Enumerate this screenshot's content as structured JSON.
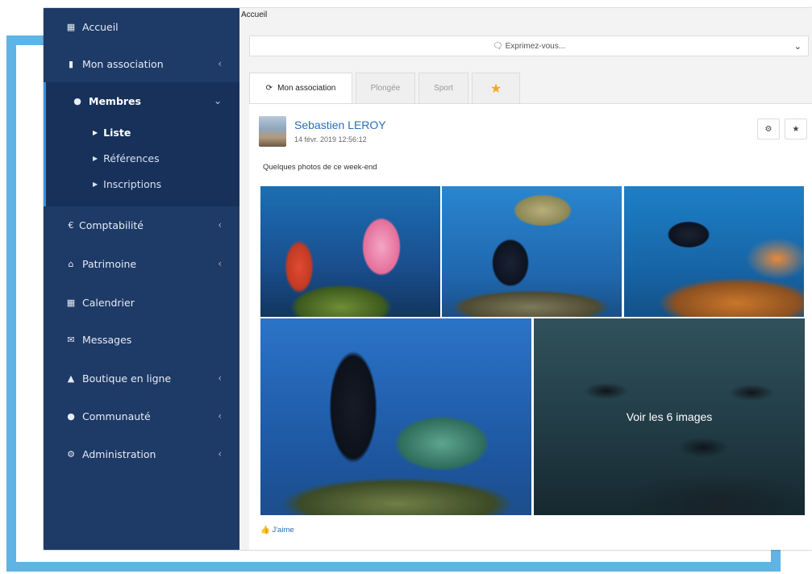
{
  "breadcrumb": "Accueil",
  "sidebar": {
    "items": [
      {
        "label": "Accueil",
        "icon": "dashboard-icon",
        "glyph": "▦",
        "chevron": ""
      },
      {
        "label": "Mon association",
        "icon": "bookmark-icon",
        "glyph": "▮",
        "chevron": "‹"
      },
      {
        "label": "Membres",
        "icon": "users-icon",
        "glyph": "👥",
        "chevron": "⌄"
      },
      {
        "label": "Comptabilité",
        "icon": "euro-icon",
        "glyph": "€",
        "chevron": "‹"
      },
      {
        "label": "Patrimoine",
        "icon": "bank-icon",
        "glyph": "🏛",
        "chevron": "‹"
      },
      {
        "label": "Calendrier",
        "icon": "calendar-icon",
        "glyph": "▦",
        "chevron": ""
      },
      {
        "label": "Messages",
        "icon": "envelope-icon",
        "glyph": "✉",
        "chevron": ""
      },
      {
        "label": "Boutique en ligne",
        "icon": "shopping-bag-icon",
        "glyph": "👜",
        "chevron": "‹"
      },
      {
        "label": "Communauté",
        "icon": "comments-icon",
        "glyph": "💬",
        "chevron": "‹"
      },
      {
        "label": "Administration",
        "icon": "cogs-icon",
        "glyph": "⚙",
        "chevron": "‹"
      }
    ],
    "submenu": [
      {
        "label": "Liste"
      },
      {
        "label": "Références"
      },
      {
        "label": "Inscriptions"
      }
    ]
  },
  "composer": {
    "placeholder": "Exprimez-vous...",
    "icon": "comment-icon"
  },
  "tabs": [
    {
      "label": "Mon association",
      "icon": "refresh-icon"
    },
    {
      "label": "Plongée"
    },
    {
      "label": "Sport"
    },
    {
      "label": "",
      "icon": "star-icon"
    }
  ],
  "post": {
    "author": "Sebastien LEROY",
    "date": "14 févr. 2019 12:56:12",
    "message": "Quelques photos de ce week-end",
    "more_images": "Voir les 6 images",
    "like_label": "J'aime"
  },
  "colors": {
    "sidebar_bg": "#1e3a66",
    "sidebar_active": "#17315a",
    "accent": "#3b8fd8",
    "link": "#2a6eb7",
    "star": "#f4a81c",
    "frame": "#5fb4e6"
  }
}
